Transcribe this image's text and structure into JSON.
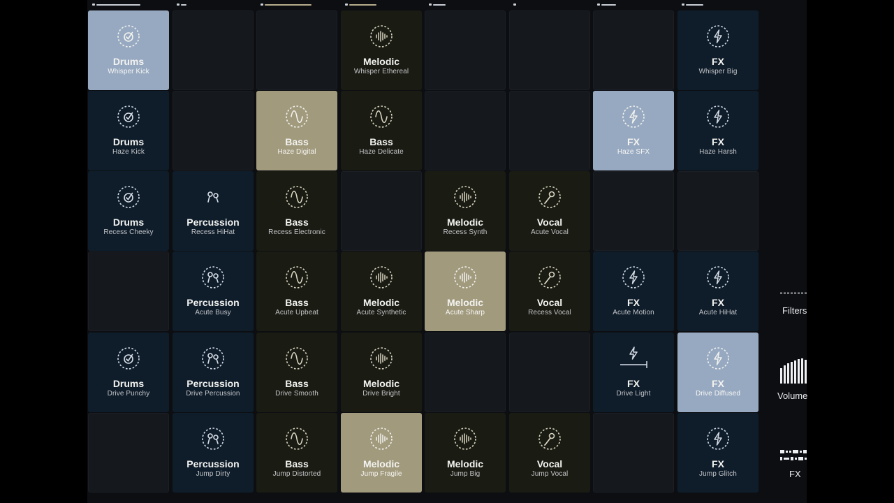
{
  "colors": {
    "blue_cell": "#0f1d2b",
    "olive_cell": "#1a1b13",
    "active_blue": "#97a9c1",
    "active_olive": "#a19a7d",
    "empty_cell": "#15181d"
  },
  "columns": [
    {
      "indicator": 0.9
    },
    {
      "indicator": 0.12
    },
    {
      "indicator": 0.95
    },
    {
      "indicator": 0.55
    },
    {
      "indicator": 0.25
    },
    {
      "indicator": 0.0
    },
    {
      "indicator": 0.3
    },
    {
      "indicator": 0.35
    }
  ],
  "grid": [
    [
      {
        "category": "Drums",
        "name": "Whisper Kick",
        "icon": "drums-icon",
        "state": "active"
      },
      {
        "empty": true
      },
      {
        "empty": true
      },
      {
        "category": "Melodic",
        "name": "Whisper Ethereal",
        "icon": "melodic-icon",
        "state": "idle"
      },
      {
        "empty": true
      },
      {
        "empty": true
      },
      {
        "empty": true
      },
      {
        "category": "FX",
        "name": "Whisper Big",
        "icon": "fx-icon",
        "state": "idle"
      }
    ],
    [
      {
        "category": "Drums",
        "name": "Haze Kick",
        "icon": "drums-icon",
        "state": "idle"
      },
      {
        "empty": true
      },
      {
        "category": "Bass",
        "name": "Haze Digital",
        "icon": "bass-icon",
        "state": "active"
      },
      {
        "category": "Bass",
        "name": "Haze Delicate",
        "icon": "bass-icon",
        "state": "idle"
      },
      {
        "empty": true
      },
      {
        "empty": true
      },
      {
        "category": "FX",
        "name": "Haze SFX",
        "icon": "fx-icon",
        "state": "active"
      },
      {
        "category": "FX",
        "name": "Haze Harsh",
        "icon": "fx-icon",
        "state": "idle"
      }
    ],
    [
      {
        "category": "Drums",
        "name": "Recess Cheeky",
        "icon": "drums-icon",
        "state": "idle"
      },
      {
        "category": "Percussion",
        "name": "Recess HiHat",
        "icon": "percussion-icon",
        "state": "idle",
        "plain_icon": true
      },
      {
        "category": "Bass",
        "name": "Recess Electronic",
        "icon": "bass-icon",
        "state": "idle"
      },
      {
        "empty": true
      },
      {
        "category": "Melodic",
        "name": "Recess Synth",
        "icon": "melodic-icon",
        "state": "idle"
      },
      {
        "category": "Vocal",
        "name": "Acute Vocal",
        "icon": "vocal-icon",
        "state": "idle"
      },
      {
        "empty": true
      },
      {
        "empty": true
      }
    ],
    [
      {
        "empty": true
      },
      {
        "category": "Percussion",
        "name": "Acute Busy",
        "icon": "percussion-icon",
        "state": "idle"
      },
      {
        "category": "Bass",
        "name": "Acute Upbeat",
        "icon": "bass-icon",
        "state": "idle"
      },
      {
        "category": "Melodic",
        "name": "Acute Synthetic",
        "icon": "melodic-icon",
        "state": "idle"
      },
      {
        "category": "Melodic",
        "name": "Acute Sharp",
        "icon": "melodic-icon",
        "state": "active"
      },
      {
        "category": "Vocal",
        "name": "Recess Vocal",
        "icon": "vocal-icon",
        "state": "idle"
      },
      {
        "category": "FX",
        "name": "Acute Motion",
        "icon": "fx-icon",
        "state": "idle"
      },
      {
        "category": "FX",
        "name": "Acute HiHat",
        "icon": "fx-icon",
        "state": "idle"
      }
    ],
    [
      {
        "category": "Drums",
        "name": "Drive Punchy",
        "icon": "drums-icon",
        "state": "idle"
      },
      {
        "category": "Percussion",
        "name": "Drive Percussion",
        "icon": "percussion-icon",
        "state": "idle"
      },
      {
        "category": "Bass",
        "name": "Drive Smooth",
        "icon": "bass-icon",
        "state": "idle"
      },
      {
        "category": "Melodic",
        "name": "Drive Bright",
        "icon": "melodic-icon",
        "state": "idle"
      },
      {
        "empty": true
      },
      {
        "empty": true
      },
      {
        "category": "FX",
        "name": "Drive Light",
        "icon": "fx-stop-icon",
        "state": "idle"
      },
      {
        "category": "FX",
        "name": "Drive Diffused",
        "icon": "fx-icon",
        "state": "active"
      }
    ],
    [
      {
        "empty": true
      },
      {
        "category": "Percussion",
        "name": "Jump Dirty",
        "icon": "percussion-icon",
        "state": "idle"
      },
      {
        "category": "Bass",
        "name": "Jump Distorted",
        "icon": "bass-icon",
        "state": "idle"
      },
      {
        "category": "Melodic",
        "name": "Jump Fragile",
        "icon": "melodic-icon",
        "state": "active"
      },
      {
        "category": "Melodic",
        "name": "Jump Big",
        "icon": "melodic-icon",
        "state": "idle"
      },
      {
        "category": "Vocal",
        "name": "Jump Vocal",
        "icon": "vocal-icon",
        "state": "idle"
      },
      {
        "empty": true
      },
      {
        "category": "FX",
        "name": "Jump Glitch",
        "icon": "fx-icon",
        "state": "idle"
      }
    ]
  ],
  "side": {
    "filters_label": "Filters",
    "volume_label": "Volume",
    "fx_label": "FX"
  }
}
